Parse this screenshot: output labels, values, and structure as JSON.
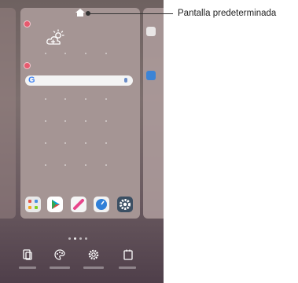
{
  "annotation": {
    "label": "Pantalla predeterminada"
  },
  "search": {
    "logo": "G"
  },
  "icons": {
    "home": "home-icon",
    "weather": "weather-cloud-sun-icon",
    "mic": "mic-icon",
    "toolbar": [
      "widgets-icon",
      "wallpaper-palette-icon",
      "settings-gear-icon",
      "app-drawer-icon"
    ]
  },
  "dock": {
    "apps": [
      "app-folder-icon",
      "play-store-icon",
      "note-pen-icon",
      "clock-icon",
      "settings-icon"
    ]
  },
  "colors": {
    "badge": "#e65a6e",
    "wallpaper": "#7d6f6e",
    "panel": "#a59594"
  }
}
